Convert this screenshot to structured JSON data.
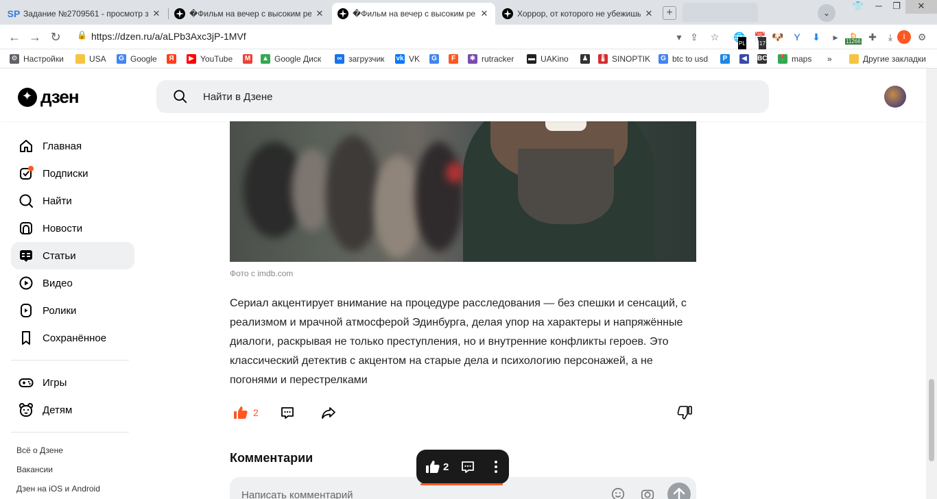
{
  "browser": {
    "tabs": [
      {
        "icon": "sp-favicon",
        "title": "Задание №2709561 - просмотр з",
        "active": false
      },
      {
        "icon": "dzen-favicon",
        "title": "�Фильм на вечер с высоким рей",
        "active": false
      },
      {
        "icon": "dzen-favicon",
        "title": "�Фильм на вечер с высоким рей",
        "active": true
      },
      {
        "icon": "dzen-favicon",
        "title": "Хоррор, от которого не убежишь",
        "active": false
      }
    ],
    "new_tab_icon": "plus-icon",
    "address": "https://dzen.ru/a/aLPb3Axc3jP-1MVf",
    "extension_badges": {
      "pl": "PL",
      "calendar": "17",
      "btc": "11266",
      "profile_letter": "I"
    },
    "bookmarks": [
      {
        "label": "Настройки",
        "icon": "gear-icon",
        "color": "#5f6368"
      },
      {
        "label": "USA",
        "icon": "folder-icon",
        "color": "#f4c542"
      },
      {
        "label": "Google",
        "icon": "google-icon",
        "color": "#4285f4"
      },
      {
        "label": "",
        "icon": "yandex-icon",
        "color": "#fc3f1d"
      },
      {
        "label": "YouTube",
        "icon": "youtube-icon",
        "color": "#ff0000"
      },
      {
        "label": "",
        "icon": "gmail-icon",
        "color": "#ea4335"
      },
      {
        "label": "Google Диск",
        "icon": "drive-icon",
        "color": "#34a853"
      },
      {
        "label": "загрузчик",
        "icon": "infinity-icon",
        "color": "#1a73e8"
      },
      {
        "label": "VK",
        "icon": "vk-icon",
        "color": "#0077ff"
      },
      {
        "label": "",
        "icon": "translate-icon",
        "color": "#4285f4"
      },
      {
        "label": "",
        "icon": "f-icon",
        "color": "#ff5722"
      },
      {
        "label": "rutracker",
        "icon": "rutracker-icon",
        "color": "#7b4caf"
      },
      {
        "label": "UAKino",
        "icon": "uakino-icon",
        "color": "#222222"
      },
      {
        "label": "",
        "icon": "person-icon",
        "color": "#333333"
      },
      {
        "label": "SINOPTIK",
        "icon": "thermometer-icon",
        "color": "#d32f2f"
      },
      {
        "label": "btc to usd",
        "icon": "google-icon",
        "color": "#4285f4"
      },
      {
        "label": "",
        "icon": "p-icon",
        "color": "#1e88e5"
      },
      {
        "label": "",
        "icon": "arrow-left-icon",
        "color": "#3949ab"
      },
      {
        "label": "",
        "icon": "bc-icon",
        "color": "#333333"
      },
      {
        "label": "maps",
        "icon": "maps-pin-icon",
        "color": "#34a853"
      }
    ],
    "bookmarks_more": "»",
    "other_bookmarks": "Другие закладки"
  },
  "header": {
    "logo_text": "дзен",
    "search_placeholder": "Найти в Дзене"
  },
  "sidebar": {
    "items": [
      {
        "label": "Главная",
        "icon": "home-icon"
      },
      {
        "label": "Подписки",
        "icon": "subscriptions-icon"
      },
      {
        "label": "Найти",
        "icon": "search-icon"
      },
      {
        "label": "Новости",
        "icon": "news-icon"
      },
      {
        "label": "Статьи",
        "icon": "articles-icon",
        "active": true
      },
      {
        "label": "Видео",
        "icon": "video-icon"
      },
      {
        "label": "Ролики",
        "icon": "shorts-icon"
      },
      {
        "label": "Сохранённое",
        "icon": "bookmark-icon"
      }
    ],
    "extra": [
      {
        "label": "Игры",
        "icon": "gamepad-icon"
      },
      {
        "label": "Детям",
        "icon": "kids-icon"
      }
    ],
    "footer": [
      "Всё о Дзене",
      "Вакансии",
      "Дзен на iOS и Android"
    ]
  },
  "article": {
    "photo_caption": "Фото с imdb.com",
    "paragraph": "Сериал акцентирует внимание на процедуре расследования — без спешки и сенсаций, с реализмом и мрачной атмосферой Эдинбурга, делая упор на характеры и напряжённые диалоги, раскрывая не только преступления, но и внутренние конфликты героев. Это классический детектив с акцентом на старые дела и психологию персонажей, а не погонями и перестрелками",
    "likes": "2"
  },
  "comments": {
    "title": "Комментарии",
    "placeholder": "Написать комментарий"
  },
  "floating_bar": {
    "likes": "2"
  },
  "colors": {
    "accent": "#ff5722",
    "surface": "#eef0f2",
    "float_bg": "#1a1a1a"
  }
}
